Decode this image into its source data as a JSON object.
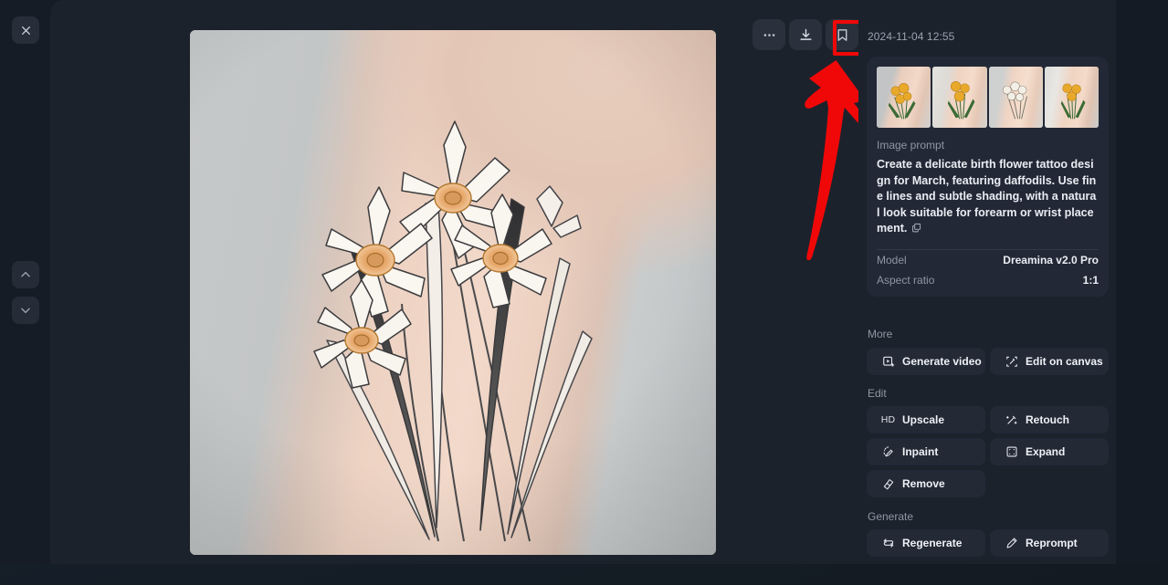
{
  "meta": {
    "accent_red": "#f00808",
    "panel_bg": "#1c222c",
    "card_bg": "#222835",
    "button_bg": "#232935"
  },
  "rail": {
    "close_label": "Close",
    "prev_label": "Previous",
    "next_label": "Next"
  },
  "stage": {
    "toolbar": [
      {
        "name": "more-options-button",
        "label": "More options",
        "icon": "ellipsis-icon"
      },
      {
        "name": "download-button",
        "label": "Download",
        "icon": "download-icon"
      },
      {
        "name": "bookmark-button",
        "label": "Bookmark",
        "icon": "bookmark-icon"
      }
    ],
    "image_alt": "Daffodil birth flower line-art tattoo on a forearm"
  },
  "annotation": {
    "type": "arrow-and-box",
    "target": "download-button",
    "color": "#f00808"
  },
  "panel": {
    "timestamp": "2024-11-04 12:55",
    "thumbnails": [
      {
        "label": "Variation 1"
      },
      {
        "label": "Variation 2"
      },
      {
        "label": "Variation 3"
      },
      {
        "label": "Variation 4"
      }
    ],
    "prompt_label": "Image prompt",
    "prompt_text": "Create a delicate birth flower tattoo design for March, featuring daffodils. Use fine lines and subtle shading, with a natural look suitable for forearm or wrist placement.",
    "copy_label": "Copy prompt",
    "meta": [
      {
        "key": "Model",
        "value": "Dreamina v2.0 Pro"
      },
      {
        "key": "Aspect ratio",
        "value": "1:1"
      }
    ],
    "sections": [
      {
        "title": "More",
        "buttons": [
          {
            "label": "Generate video",
            "icon": "video-frame-icon",
            "name": "generate-video-button"
          },
          {
            "label": "Edit on canvas",
            "icon": "canvas-crop-icon",
            "name": "edit-on-canvas-button"
          }
        ]
      },
      {
        "title": "Edit",
        "buttons": [
          {
            "label": "Upscale",
            "icon": "hd-icon",
            "name": "upscale-button"
          },
          {
            "label": "Retouch",
            "icon": "magic-wand-icon",
            "name": "retouch-button"
          },
          {
            "label": "Inpaint",
            "icon": "inpaint-brush-icon",
            "name": "inpaint-button"
          },
          {
            "label": "Expand",
            "icon": "expand-icon",
            "name": "expand-button"
          },
          {
            "label": "Remove",
            "icon": "eraser-icon",
            "name": "remove-button"
          }
        ]
      },
      {
        "title": "Generate",
        "buttons": [
          {
            "label": "Regenerate",
            "icon": "refresh-icon",
            "name": "regenerate-button"
          },
          {
            "label": "Reprompt",
            "icon": "pencil-icon",
            "name": "reprompt-button"
          }
        ]
      }
    ]
  }
}
